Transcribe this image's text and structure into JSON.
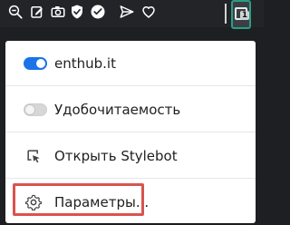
{
  "toolbar": {
    "icons": [
      "zoom-out-icon",
      "edit-icon",
      "camera-icon",
      "shield-check-icon",
      "badge-icon",
      "send-icon",
      "heart-icon",
      "extension-icon"
    ],
    "active_extension_badge": "1"
  },
  "popup": {
    "items": [
      {
        "label": "enthub.it",
        "toggle": "on"
      },
      {
        "label": "Удобочитаемость",
        "toggle": "off"
      },
      {
        "label": "Открыть Stylebot",
        "icon": "cursor-frame-icon"
      },
      {
        "label": "Параметры...",
        "icon": "gear-icon"
      }
    ]
  },
  "colors": {
    "toggle_on": "#1a73e8",
    "highlight": "#d9534f",
    "active_extension_border": "#2a9d86"
  }
}
